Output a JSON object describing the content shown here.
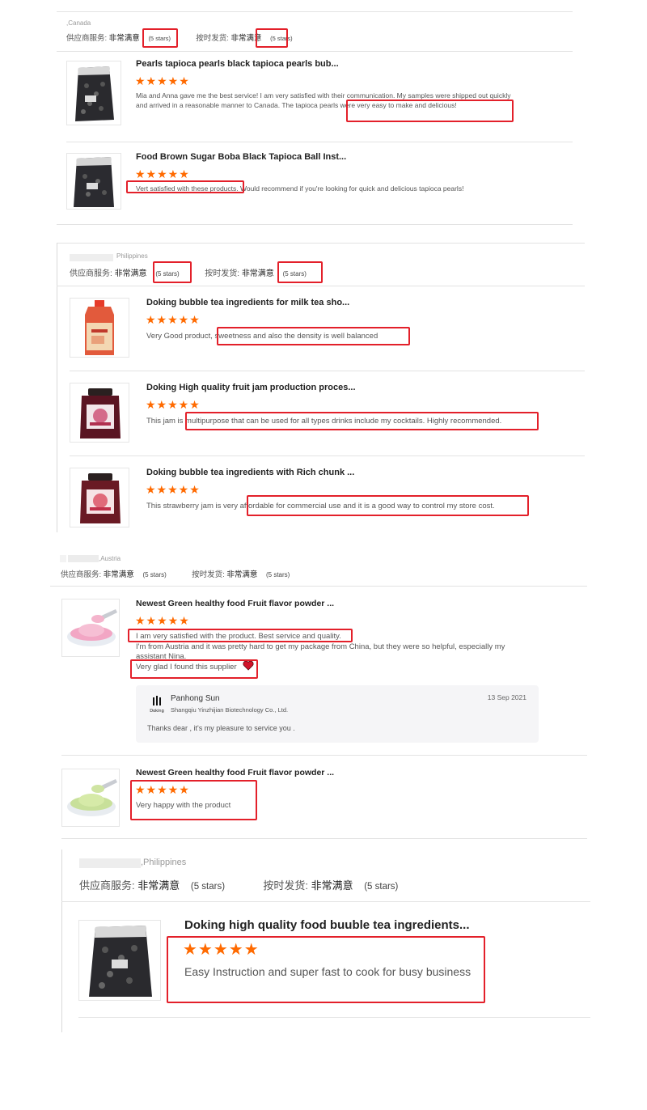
{
  "reviews": [
    {
      "location": ",Canada",
      "ratings": {
        "service_label": "供应商服务:",
        "service_value": "非常满意",
        "service_stars": "(5 stars)",
        "shipping_label": "按时发货:",
        "shipping_value": "非常满意",
        "shipping_stars": "(5 stars)"
      },
      "items": [
        {
          "title": "Pearls tapioca pearls black tapioca pearls bub...",
          "stars": "★★★★★",
          "comment": "Mia and Anna gave me the best service! I am very satisfied with their communication. My samples were shipped out quickly and arrived in a reasonable manner to Canada. The tapioca pearls were very easy to make and delicious!"
        },
        {
          "title": "Food Brown Sugar Boba Black Tapioca Ball Inst...",
          "stars": "★★★★★",
          "comment": "Vert satisfied with these products. Would recommend if you're looking for quick and delicious tapioca pearls!"
        }
      ]
    },
    {
      "location": "Philippines",
      "ratings": {
        "service_label": "供应商服务:",
        "service_value": "非常满意",
        "service_stars": "(5 stars)",
        "shipping_label": "按时发货:",
        "shipping_value": "非常满意",
        "shipping_stars": "(5 stars)"
      },
      "items": [
        {
          "title": "Doking bubble tea ingredients for milk tea sho...",
          "stars": "★★★★★",
          "comment": "Very Good product, sweetness and also the density is well balanced"
        },
        {
          "title": "Doking High quality fruit jam production proces...",
          "stars": "★★★★★",
          "comment": "This jam is multipurpose that can be used for all types drinks include my cocktails. Highly recommended."
        },
        {
          "title": "Doking bubble tea ingredients with Rich chunk ...",
          "stars": "★★★★★",
          "comment": "This strawberry jam is very affordable for commercial use and it is a good way to control my store cost."
        }
      ]
    },
    {
      "location": ",Austria",
      "ratings": {
        "service_label": "供应商服务:",
        "service_value": "非常满意",
        "service_stars": "(5 stars)",
        "shipping_label": "按时发货:",
        "shipping_value": "非常满意",
        "shipping_stars": "(5 stars)"
      },
      "items": [
        {
          "title": "Newest Green healthy food Fruit flavor powder ...",
          "stars": "★★★★★",
          "comment_line1": "I am very satisfied with the product. Best service and quality.",
          "comment_line2": "I'm from Austria and it was pretty hard to get my package from China, but they were so helpful, especially my assistant Nina.",
          "comment_line3": "Very glad I found this supplier",
          "reply": {
            "name": "Panhong Sun",
            "company": "Shangqiu Yinzhijian Biotechnology Co., Ltd.",
            "date": "13 Sep 2021",
            "text": "Thanks dear , it's my pleasure to service you .",
            "logo_text": "Doking"
          }
        },
        {
          "title": "Newest Green healthy food Fruit flavor powder ...",
          "stars": "★★★★★",
          "comment": "Very happy with the product"
        }
      ]
    },
    {
      "location": ",Philippines",
      "ratings": {
        "service_label": "供应商服务:",
        "service_value": "非常满意",
        "service_stars": "(5 stars)",
        "shipping_label": "按时发货:",
        "shipping_value": "非常满意",
        "shipping_stars": "(5 stars)"
      },
      "items": [
        {
          "title": "Doking high quality food buuble tea ingredients...",
          "stars": "★★★★★",
          "comment": "Easy Instruction and super fast to cook for busy business"
        }
      ]
    }
  ],
  "colors": {
    "star": "#ff6a00",
    "highlight_box": "#e3202a",
    "heart": "#d0142a"
  }
}
